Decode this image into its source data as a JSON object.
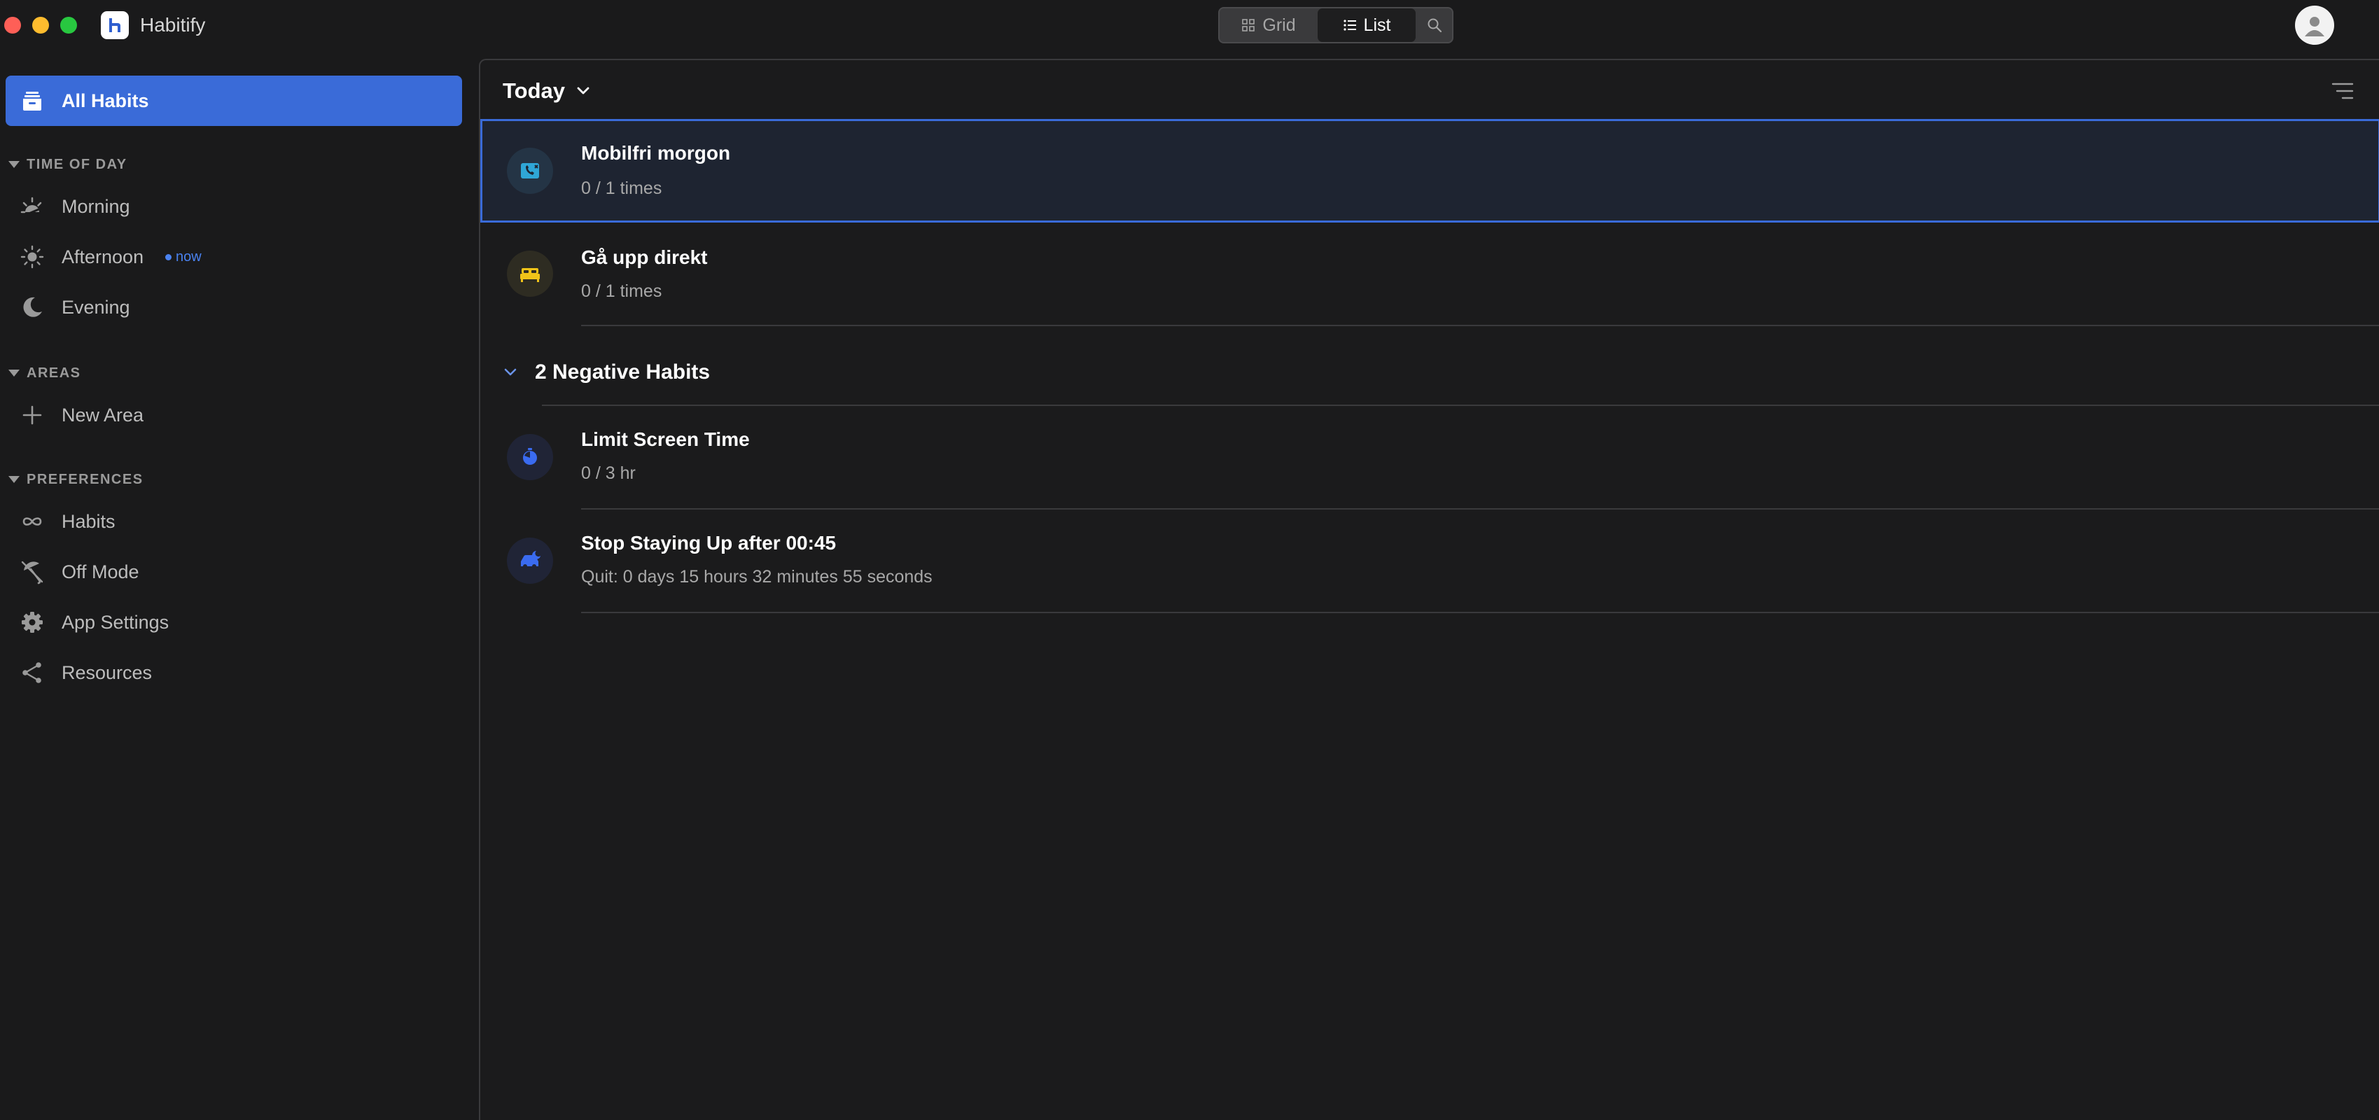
{
  "app": {
    "title": "Habitify"
  },
  "view_switcher": {
    "grid_label": "Grid",
    "list_label": "List",
    "active": "List"
  },
  "sidebar": {
    "all_habits_label": "All Habits",
    "time_of_day": {
      "header": "TIME OF DAY",
      "items": [
        {
          "label": "Morning",
          "icon": "sunrise-icon"
        },
        {
          "label": "Afternoon",
          "icon": "sun-icon",
          "badge": "now"
        },
        {
          "label": "Evening",
          "icon": "moon-icon"
        }
      ]
    },
    "areas": {
      "header": "AREAS",
      "new_area_label": "New Area"
    },
    "preferences": {
      "header": "PREFERENCES",
      "items": [
        {
          "label": "Habits",
          "icon": "infinity-icon"
        },
        {
          "label": "Off Mode",
          "icon": "umbrella-off-icon"
        },
        {
          "label": "App Settings",
          "icon": "gear-icon"
        },
        {
          "label": "Resources",
          "icon": "share-icon"
        }
      ]
    }
  },
  "main": {
    "date_filter": "Today",
    "habits": [
      {
        "name": "Mobilfri morgon",
        "progress": "0 / 1 times",
        "icon": "phone-off-icon",
        "icon_color": "#2fa6d6",
        "selected": true
      },
      {
        "name": "Gå upp direkt",
        "progress": "0 / 1 times",
        "icon": "bed-icon",
        "icon_color": "#f0c419"
      }
    ],
    "negative_group": {
      "title": "2 Negative Habits",
      "habits": [
        {
          "name": "Limit Screen Time",
          "progress": "0 / 3 hr",
          "icon": "timer-icon",
          "icon_color": "#3a6bf0"
        },
        {
          "name": "Stop Staying Up after 00:45",
          "progress": "Quit: 0 days 15 hours 32 minutes 55 seconds",
          "icon": "night-car-icon",
          "icon_color": "#3a6bf0"
        }
      ]
    }
  },
  "colors": {
    "accent": "#3a6bd8",
    "background": "#1a1a1b",
    "now_badge": "#4a82f0"
  }
}
